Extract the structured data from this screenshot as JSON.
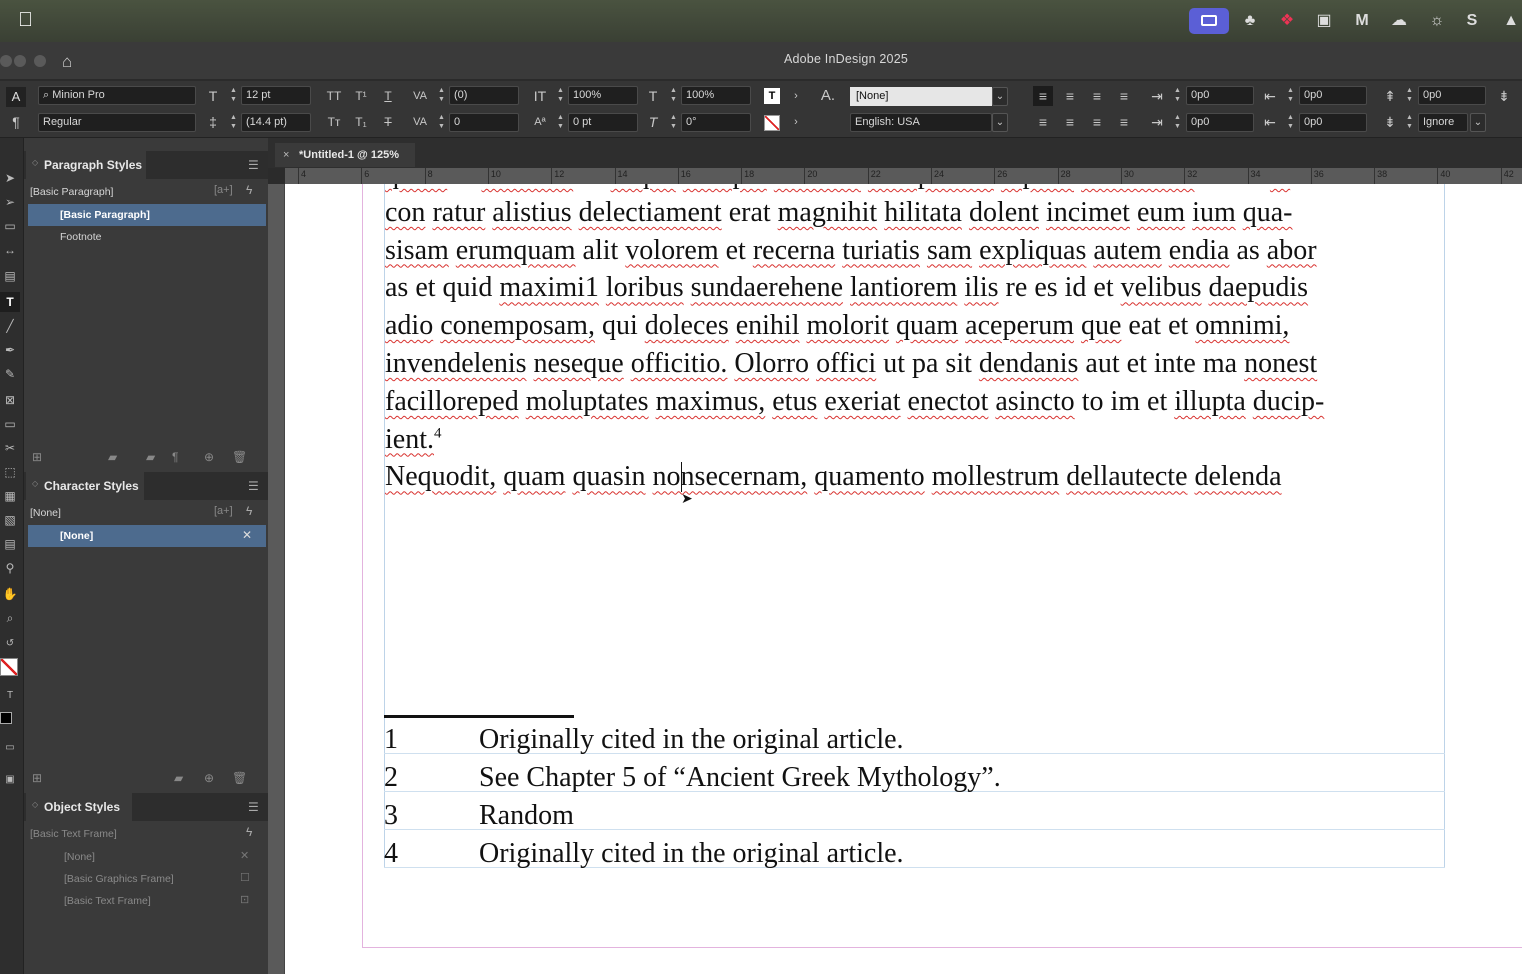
{
  "app": {
    "title": "Adobe InDesign 2025"
  },
  "menubar": {
    "icons": [
      "apple-icon",
      "screen-share-icon",
      "teams-icon",
      "dropbox-icon",
      "outlook-icon",
      "maps-icon",
      "cloud-icon",
      "creative-cloud-icon",
      "skype-icon",
      "drive-icon"
    ]
  },
  "control_bar": {
    "font_family": "Minion Pro",
    "font_style": "Regular",
    "font_size": "12 pt",
    "leading": "(14.4 pt)",
    "kerning": "(0)",
    "tracking": "0",
    "vscale": "100%",
    "hscale": "100%",
    "baseline": "0 pt",
    "skew": "0°",
    "char_style": "[None]",
    "language": "English: USA",
    "left_indent": "0p0",
    "first_indent": "0p0",
    "right_indent": "0p0",
    "last_indent": "0p0",
    "space_before": "0p0",
    "space_after": "0p0",
    "space_before2": "0p0",
    "align_grid": "Ignore"
  },
  "document_tab": {
    "label": "*Untitled-1 @ 125%"
  },
  "panels": {
    "paragraph_styles": {
      "title": "Paragraph Styles",
      "current": "[Basic Paragraph]",
      "items": [
        "[Basic Paragraph]",
        "Footnote"
      ]
    },
    "character_styles": {
      "title": "Character Styles",
      "current": "[None]",
      "items": [
        "[None]"
      ]
    },
    "object_styles": {
      "title": "Object Styles",
      "current": "[Basic Text Frame]",
      "items": [
        "[None]",
        "[Basic Graphics Frame]",
        "[Basic Text Frame]"
      ]
    }
  },
  "ruler": {
    "h": [
      "4",
      "6",
      "8",
      "10",
      "12",
      "14",
      "16",
      "18",
      "20",
      "22",
      "24",
      "26",
      "28",
      "30",
      "32",
      "34",
      "36",
      "38",
      "40",
      "42"
    ]
  },
  "body_lines": [
    "quam et lamstior as eaque volupta temnias voluptatem ulparit atmetatias et aut la",
    "con ratur alistius delectiament erat magnihit hilitata dolent incimet eum ium qua-",
    "sisam erumquam alit volorem et recerna turiatis sam expliquas autem endia as abor",
    "as et quid maximi1 loribus sundaerehene lantiorem ilis re es id et velibus daepudis",
    "adio conemposam, qui doleces enihil molorit quam aceperum que eat et omnimi,",
    "invendelenis neseque officitio. Olorro offici ut pa sit dendanis aut et inte ma nonest",
    "facilloreped moluptates maximus, etus exeriat enectot asincto to im et illupta ducip-",
    "ient.",
    "Nequodit, quam quasin nonsecernam, quamento mollestrum dellautecte delenda"
  ],
  "footnote_ref": "4",
  "footnotes": [
    {
      "num": "1",
      "text": "Originally cited in the original article."
    },
    {
      "num": "2",
      "text": "See Chapter 5 of “Ancient Greek Mythology”."
    },
    {
      "num": "3",
      "text": "Random"
    },
    {
      "num": "4",
      "text": "Originally cited in the original article."
    }
  ]
}
